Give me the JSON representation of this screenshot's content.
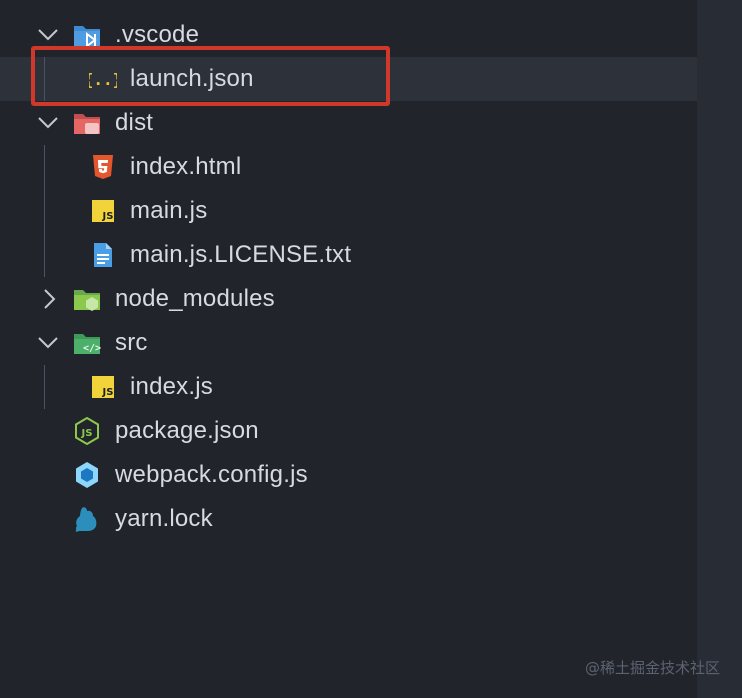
{
  "tree": {
    "vscode_folder": {
      "label": ".vscode",
      "icon": "folder-vscode-icon",
      "expanded": true
    },
    "launch_json": {
      "label": "launch.json",
      "icon": "json-braces-icon",
      "selected": true
    },
    "dist_folder": {
      "label": "dist",
      "icon": "folder-dist-icon",
      "expanded": true
    },
    "index_html": {
      "label": "index.html",
      "icon": "html5-icon"
    },
    "main_js": {
      "label": "main.js",
      "icon": "javascript-icon"
    },
    "main_license": {
      "label": "main.js.LICENSE.txt",
      "icon": "text-file-icon"
    },
    "node_modules_folder": {
      "label": "node_modules",
      "icon": "folder-node-icon",
      "expanded": false
    },
    "src_folder": {
      "label": "src",
      "icon": "folder-src-icon",
      "expanded": true
    },
    "index_js": {
      "label": "index.js",
      "icon": "javascript-icon"
    },
    "package_json": {
      "label": "package.json",
      "icon": "nodejs-icon"
    },
    "webpack_config": {
      "label": "webpack.config.js",
      "icon": "webpack-icon"
    },
    "yarn_lock": {
      "label": "yarn.lock",
      "icon": "yarn-icon"
    }
  },
  "watermark": "@稀土掘金技术社区",
  "colors": {
    "background": "#21252b",
    "selected_row": "#2c313a",
    "highlight_border": "#d0392a",
    "text": "#d7dae0"
  }
}
